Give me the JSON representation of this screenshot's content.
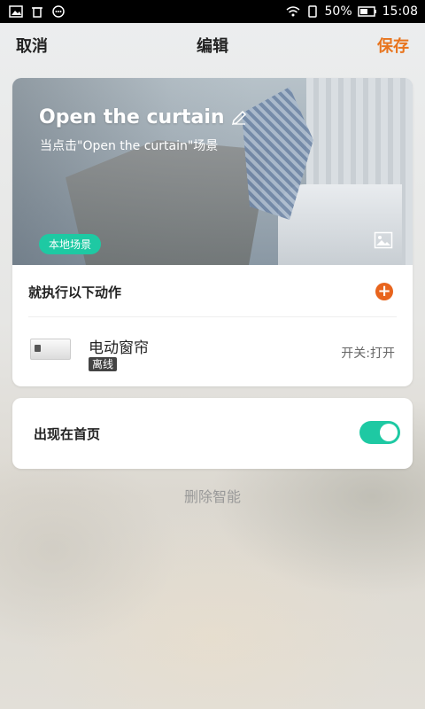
{
  "status_bar": {
    "battery_percent": "50%",
    "time": "15:08",
    "icons": [
      "gallery-icon",
      "trash-icon",
      "chat-bubble-icon",
      "wifi-icon",
      "sim-icon",
      "battery-icon"
    ]
  },
  "nav": {
    "cancel_label": "取消",
    "title": "编辑",
    "save_label": "保存",
    "save_color": "#e8741d"
  },
  "scene": {
    "title": "Open the curtain",
    "subtitle": "当点击\"Open the curtain\"场景",
    "tag": "本地场景",
    "tag_color": "#1ec9a3"
  },
  "actions": {
    "section_title": "就执行以下动作",
    "add_label": "+",
    "items": [
      {
        "name": "电动窗帘",
        "status": "离线",
        "action": "开关:打开"
      }
    ]
  },
  "home": {
    "label": "出现在首页",
    "toggle_on": true
  },
  "delete_label": "删除智能"
}
